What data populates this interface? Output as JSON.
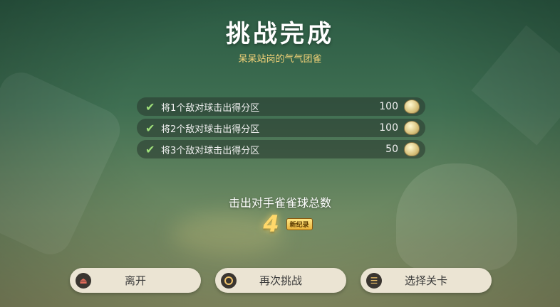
{
  "header": {
    "title": "挑战完成",
    "subtitle": "呆呆站岗的气气团雀"
  },
  "tasks": [
    {
      "label": "将1个敌对球击出得分区",
      "reward": "100",
      "icon": "coin-icon"
    },
    {
      "label": "将2个敌对球击出得分区",
      "reward": "100",
      "icon": "coin-icon"
    },
    {
      "label": "将3个敌对球击出得分区",
      "reward": "50",
      "icon": "coin-icon"
    }
  ],
  "result": {
    "label": "击出对手雀雀球总数",
    "value": "4",
    "badge": "新纪录"
  },
  "buttons": {
    "leave": "离开",
    "retry": "再次挑战",
    "select": "选择关卡"
  },
  "colors": {
    "accent_gold": "#f6d479",
    "check_green": "#9fe07a",
    "button_bg": "#ebe4d3"
  }
}
